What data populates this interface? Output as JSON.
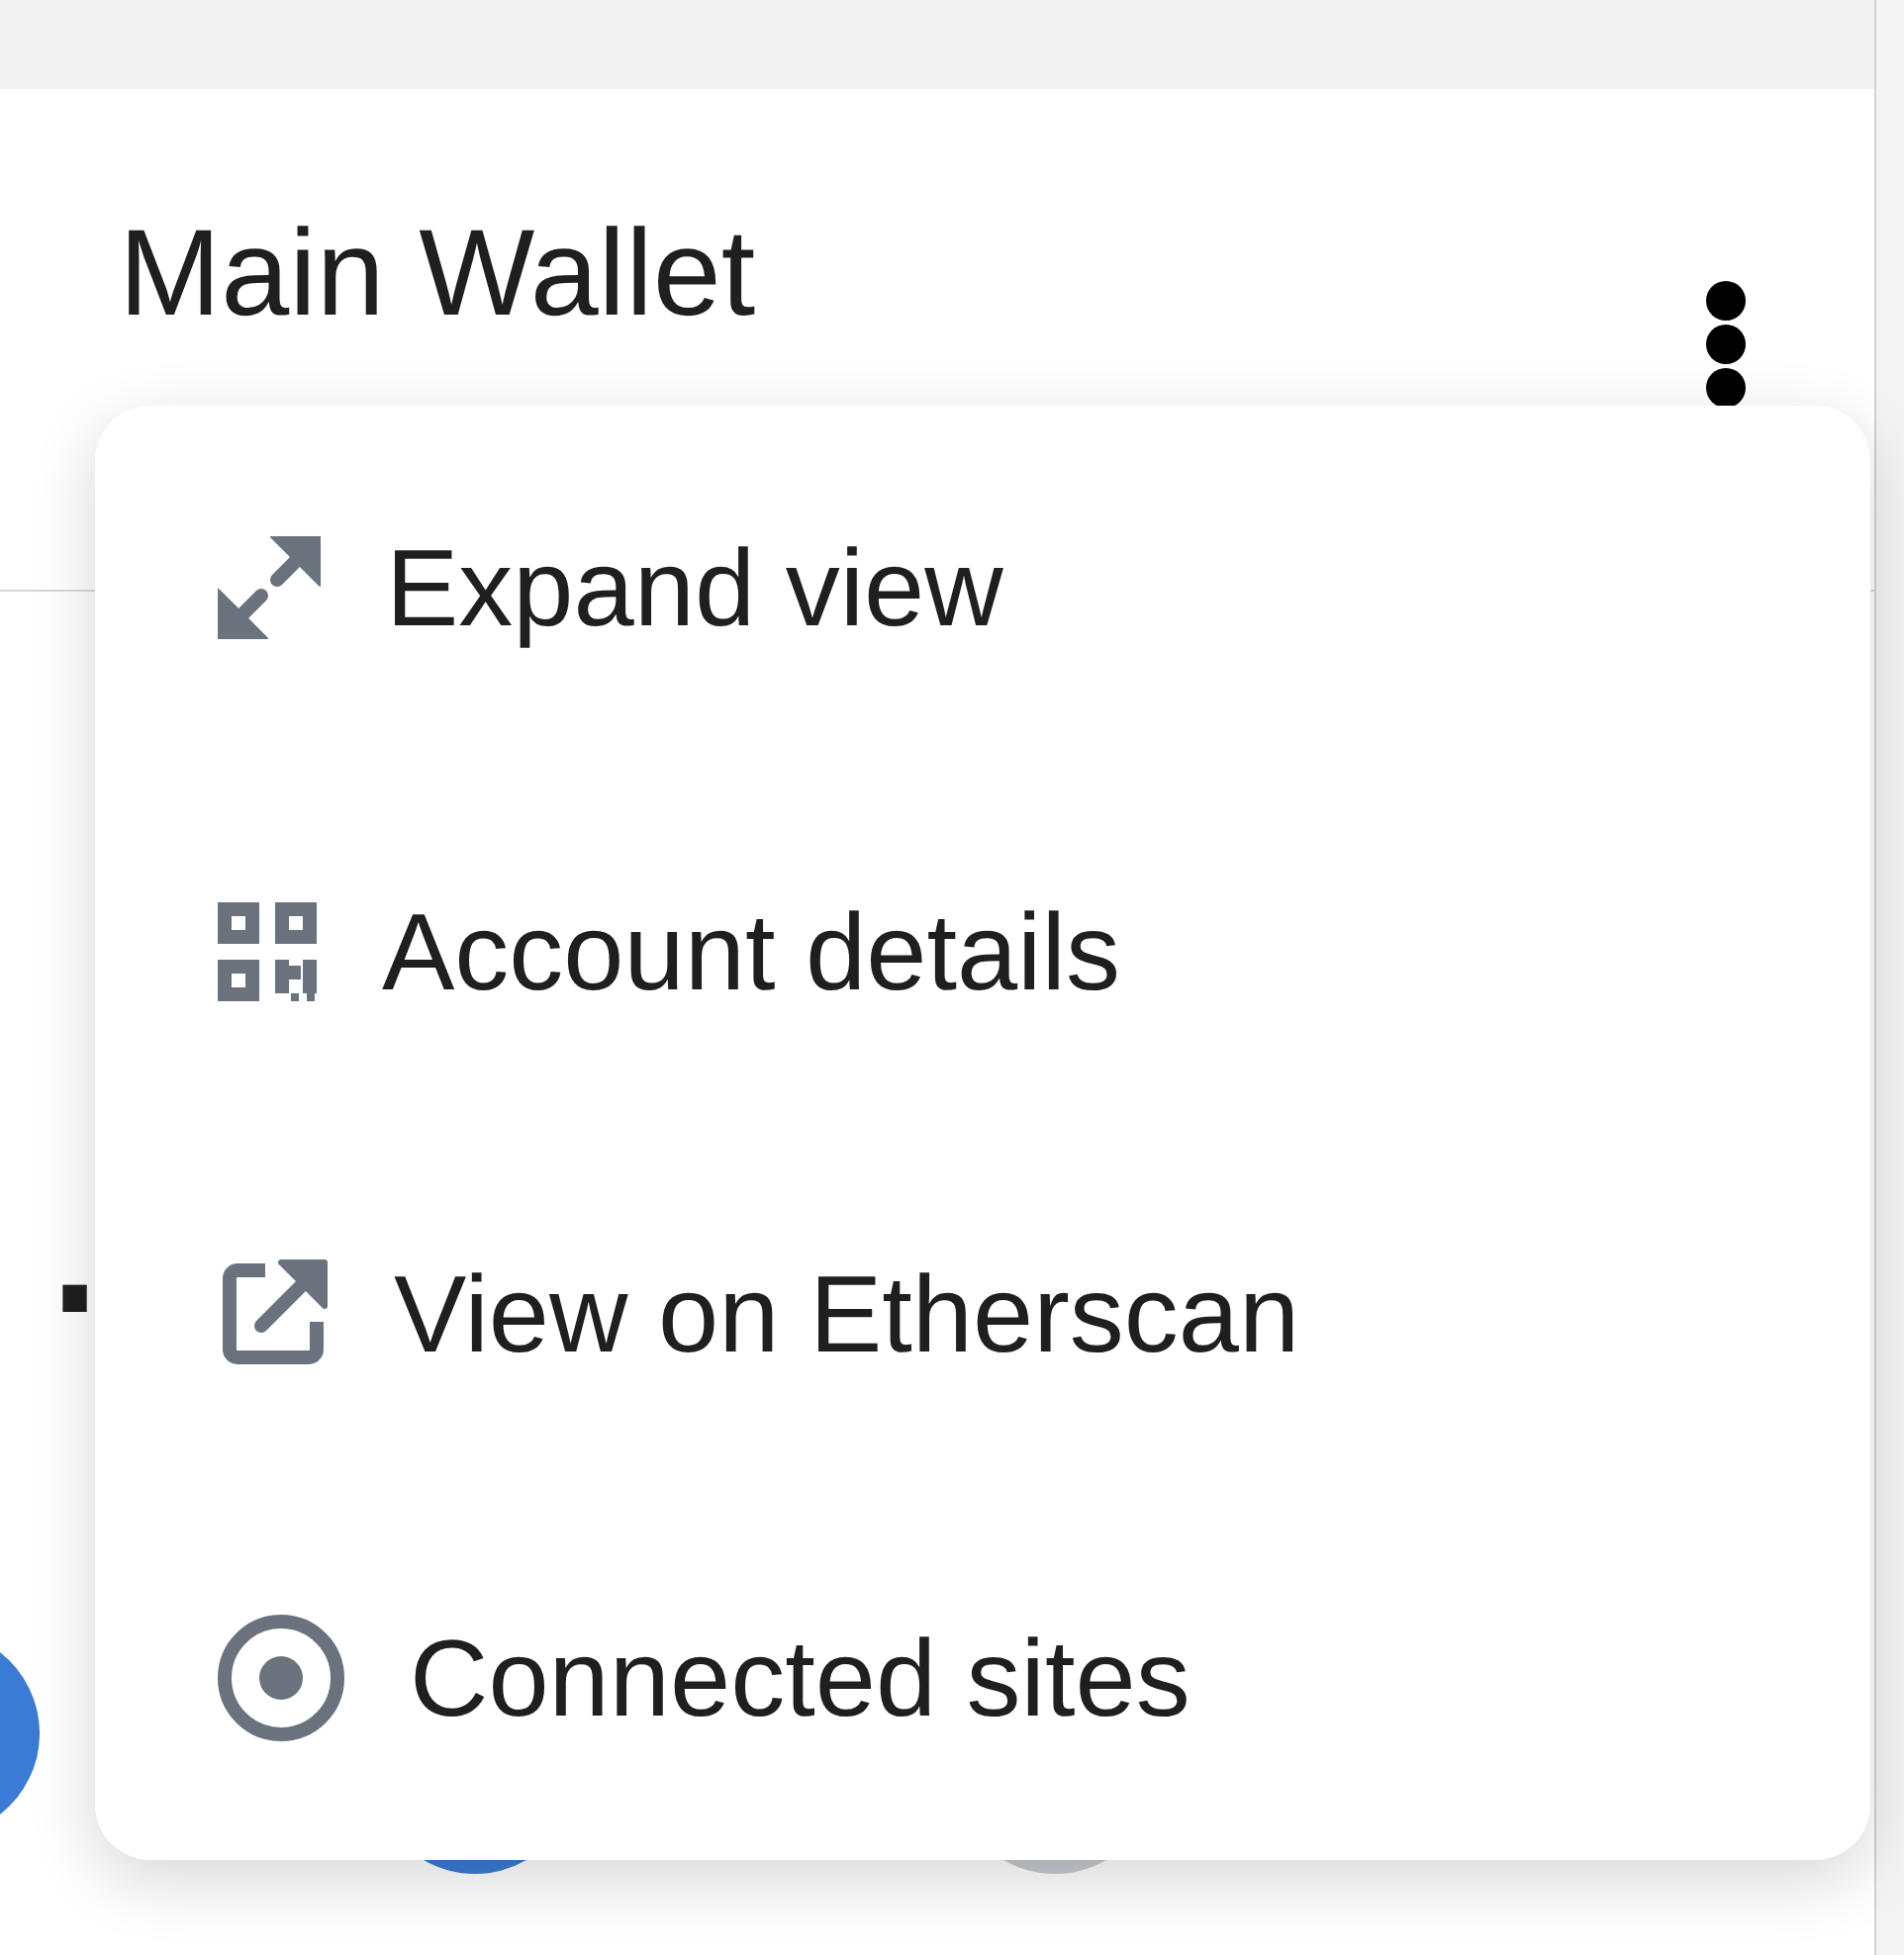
{
  "account": {
    "name": "Main Wallet"
  },
  "balance": {
    "amount": "."
  },
  "menu": {
    "items": [
      {
        "kind": "expand",
        "label": "Expand view"
      },
      {
        "kind": "details",
        "label": "Account details"
      },
      {
        "kind": "explorer",
        "label": "View on Etherscan"
      },
      {
        "kind": "sites",
        "label": "Connected sites"
      }
    ]
  }
}
